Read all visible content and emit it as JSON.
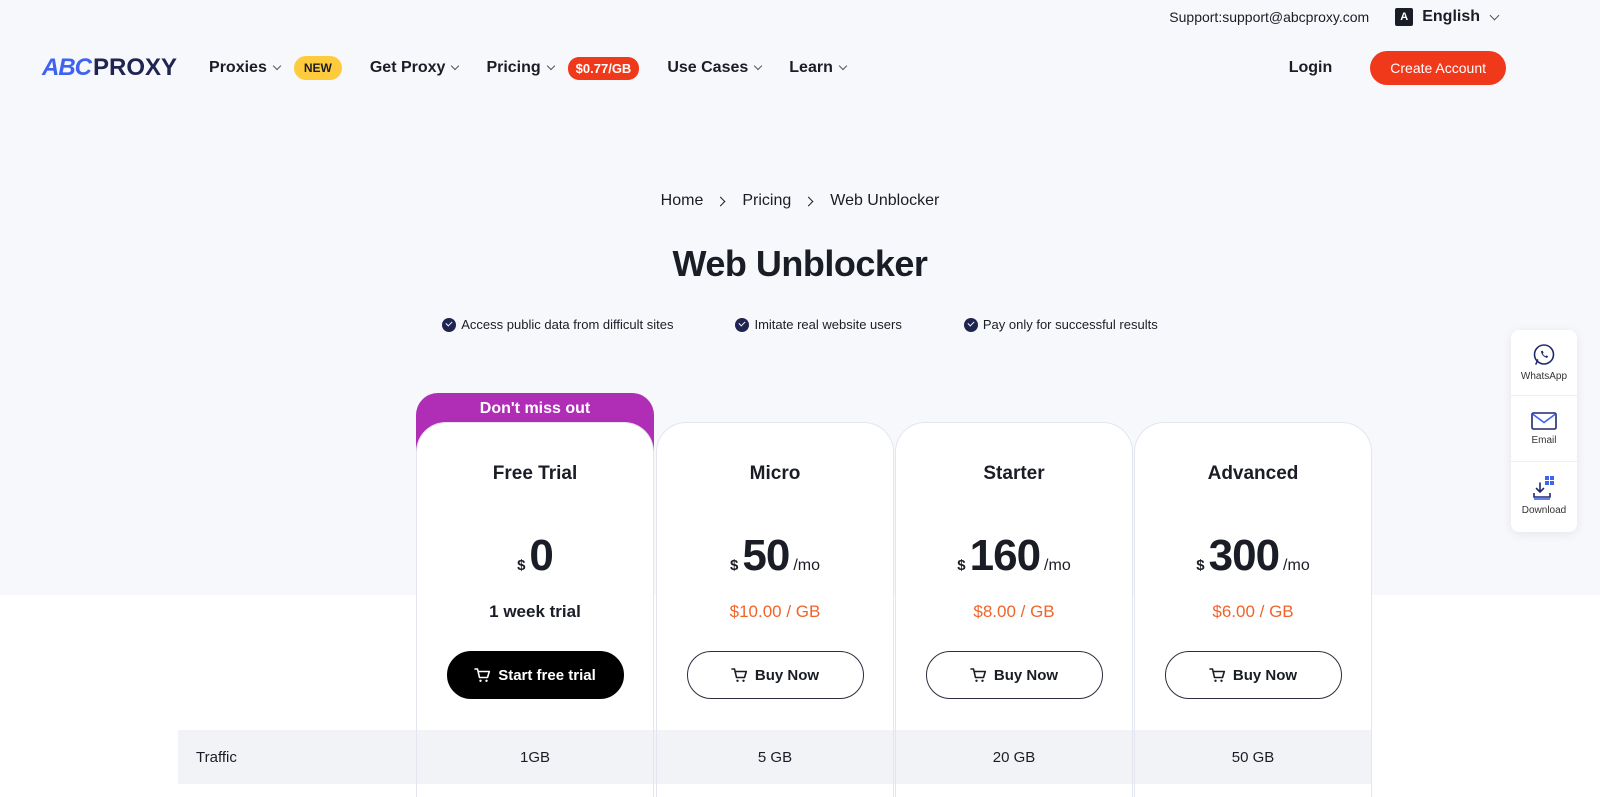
{
  "topbar": {
    "support_text": "Support:support@abcproxy.com",
    "language": "English",
    "language_icon_letter": "A"
  },
  "nav": {
    "logo_abc": "ABC",
    "logo_proxy": "PROXY",
    "items": [
      {
        "label": "Proxies",
        "badge": "NEW"
      },
      {
        "label": "Get Proxy"
      },
      {
        "label": "Pricing",
        "badge": "$0.77/GB"
      },
      {
        "label": "Use Cases"
      },
      {
        "label": "Learn"
      }
    ],
    "login": "Login",
    "create_account": "Create Account"
  },
  "breadcrumb": [
    "Home",
    "Pricing",
    "Web Unblocker"
  ],
  "page_title": "Web Unblocker",
  "features": [
    "Access public data from difficult sites",
    "Imitate real website users",
    "Pay only for successful results"
  ],
  "promo": "Don't miss out",
  "plans": [
    {
      "name": "Free Trial",
      "currency": "$",
      "amount": "0",
      "period": "",
      "rate": "1 week trial",
      "cta": "Start free trial",
      "traffic": "1GB"
    },
    {
      "name": "Micro",
      "currency": "$",
      "amount": "50",
      "period": "/mo",
      "rate": "$10.00 / GB",
      "cta": "Buy Now",
      "traffic": "5 GB"
    },
    {
      "name": "Starter",
      "currency": "$",
      "amount": "160",
      "period": "/mo",
      "rate": "$8.00 / GB",
      "cta": "Buy Now",
      "traffic": "20 GB"
    },
    {
      "name": "Advanced",
      "currency": "$",
      "amount": "300",
      "period": "/mo",
      "rate": "$6.00 / GB",
      "cta": "Buy Now",
      "traffic": "50 GB"
    }
  ],
  "table": {
    "row_label": "Traffic"
  },
  "contact": [
    "WhatsApp",
    "Email",
    "Download"
  ],
  "colors": {
    "accent": "#f0381a",
    "promo": "#b02db5",
    "badge_new": "#fdcb3c",
    "rate": "#f0642a",
    "logo_blue": "#3e63f2"
  }
}
